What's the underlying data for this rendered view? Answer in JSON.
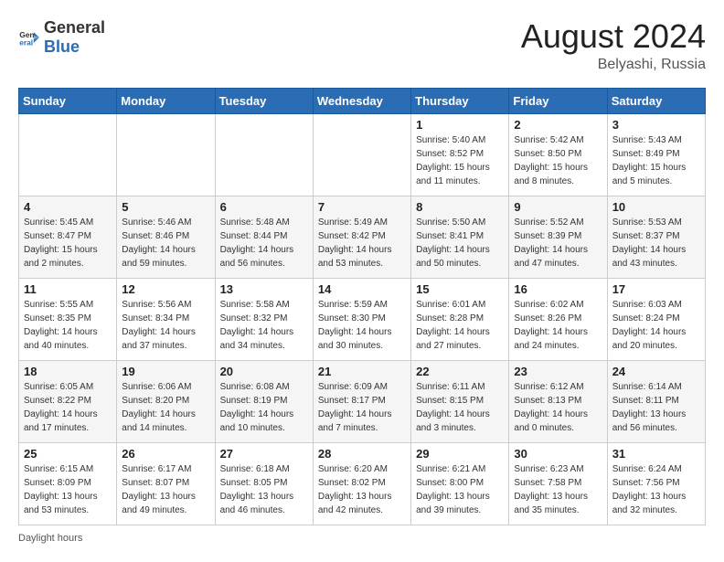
{
  "logo": {
    "general": "General",
    "blue": "Blue"
  },
  "title": {
    "month_year": "August 2024",
    "location": "Belyashi, Russia"
  },
  "days_of_week": [
    "Sunday",
    "Monday",
    "Tuesday",
    "Wednesday",
    "Thursday",
    "Friday",
    "Saturday"
  ],
  "weeks": [
    [
      {
        "day": "",
        "sunrise": "",
        "sunset": "",
        "daylight": ""
      },
      {
        "day": "",
        "sunrise": "",
        "sunset": "",
        "daylight": ""
      },
      {
        "day": "",
        "sunrise": "",
        "sunset": "",
        "daylight": ""
      },
      {
        "day": "",
        "sunrise": "",
        "sunset": "",
        "daylight": ""
      },
      {
        "day": "1",
        "sunrise": "Sunrise: 5:40 AM",
        "sunset": "Sunset: 8:52 PM",
        "daylight": "Daylight: 15 hours and 11 minutes."
      },
      {
        "day": "2",
        "sunrise": "Sunrise: 5:42 AM",
        "sunset": "Sunset: 8:50 PM",
        "daylight": "Daylight: 15 hours and 8 minutes."
      },
      {
        "day": "3",
        "sunrise": "Sunrise: 5:43 AM",
        "sunset": "Sunset: 8:49 PM",
        "daylight": "Daylight: 15 hours and 5 minutes."
      }
    ],
    [
      {
        "day": "4",
        "sunrise": "Sunrise: 5:45 AM",
        "sunset": "Sunset: 8:47 PM",
        "daylight": "Daylight: 15 hours and 2 minutes."
      },
      {
        "day": "5",
        "sunrise": "Sunrise: 5:46 AM",
        "sunset": "Sunset: 8:46 PM",
        "daylight": "Daylight: 14 hours and 59 minutes."
      },
      {
        "day": "6",
        "sunrise": "Sunrise: 5:48 AM",
        "sunset": "Sunset: 8:44 PM",
        "daylight": "Daylight: 14 hours and 56 minutes."
      },
      {
        "day": "7",
        "sunrise": "Sunrise: 5:49 AM",
        "sunset": "Sunset: 8:42 PM",
        "daylight": "Daylight: 14 hours and 53 minutes."
      },
      {
        "day": "8",
        "sunrise": "Sunrise: 5:50 AM",
        "sunset": "Sunset: 8:41 PM",
        "daylight": "Daylight: 14 hours and 50 minutes."
      },
      {
        "day": "9",
        "sunrise": "Sunrise: 5:52 AM",
        "sunset": "Sunset: 8:39 PM",
        "daylight": "Daylight: 14 hours and 47 minutes."
      },
      {
        "day": "10",
        "sunrise": "Sunrise: 5:53 AM",
        "sunset": "Sunset: 8:37 PM",
        "daylight": "Daylight: 14 hours and 43 minutes."
      }
    ],
    [
      {
        "day": "11",
        "sunrise": "Sunrise: 5:55 AM",
        "sunset": "Sunset: 8:35 PM",
        "daylight": "Daylight: 14 hours and 40 minutes."
      },
      {
        "day": "12",
        "sunrise": "Sunrise: 5:56 AM",
        "sunset": "Sunset: 8:34 PM",
        "daylight": "Daylight: 14 hours and 37 minutes."
      },
      {
        "day": "13",
        "sunrise": "Sunrise: 5:58 AM",
        "sunset": "Sunset: 8:32 PM",
        "daylight": "Daylight: 14 hours and 34 minutes."
      },
      {
        "day": "14",
        "sunrise": "Sunrise: 5:59 AM",
        "sunset": "Sunset: 8:30 PM",
        "daylight": "Daylight: 14 hours and 30 minutes."
      },
      {
        "day": "15",
        "sunrise": "Sunrise: 6:01 AM",
        "sunset": "Sunset: 8:28 PM",
        "daylight": "Daylight: 14 hours and 27 minutes."
      },
      {
        "day": "16",
        "sunrise": "Sunrise: 6:02 AM",
        "sunset": "Sunset: 8:26 PM",
        "daylight": "Daylight: 14 hours and 24 minutes."
      },
      {
        "day": "17",
        "sunrise": "Sunrise: 6:03 AM",
        "sunset": "Sunset: 8:24 PM",
        "daylight": "Daylight: 14 hours and 20 minutes."
      }
    ],
    [
      {
        "day": "18",
        "sunrise": "Sunrise: 6:05 AM",
        "sunset": "Sunset: 8:22 PM",
        "daylight": "Daylight: 14 hours and 17 minutes."
      },
      {
        "day": "19",
        "sunrise": "Sunrise: 6:06 AM",
        "sunset": "Sunset: 8:20 PM",
        "daylight": "Daylight: 14 hours and 14 minutes."
      },
      {
        "day": "20",
        "sunrise": "Sunrise: 6:08 AM",
        "sunset": "Sunset: 8:19 PM",
        "daylight": "Daylight: 14 hours and 10 minutes."
      },
      {
        "day": "21",
        "sunrise": "Sunrise: 6:09 AM",
        "sunset": "Sunset: 8:17 PM",
        "daylight": "Daylight: 14 hours and 7 minutes."
      },
      {
        "day": "22",
        "sunrise": "Sunrise: 6:11 AM",
        "sunset": "Sunset: 8:15 PM",
        "daylight": "Daylight: 14 hours and 3 minutes."
      },
      {
        "day": "23",
        "sunrise": "Sunrise: 6:12 AM",
        "sunset": "Sunset: 8:13 PM",
        "daylight": "Daylight: 14 hours and 0 minutes."
      },
      {
        "day": "24",
        "sunrise": "Sunrise: 6:14 AM",
        "sunset": "Sunset: 8:11 PM",
        "daylight": "Daylight: 13 hours and 56 minutes."
      }
    ],
    [
      {
        "day": "25",
        "sunrise": "Sunrise: 6:15 AM",
        "sunset": "Sunset: 8:09 PM",
        "daylight": "Daylight: 13 hours and 53 minutes."
      },
      {
        "day": "26",
        "sunrise": "Sunrise: 6:17 AM",
        "sunset": "Sunset: 8:07 PM",
        "daylight": "Daylight: 13 hours and 49 minutes."
      },
      {
        "day": "27",
        "sunrise": "Sunrise: 6:18 AM",
        "sunset": "Sunset: 8:05 PM",
        "daylight": "Daylight: 13 hours and 46 minutes."
      },
      {
        "day": "28",
        "sunrise": "Sunrise: 6:20 AM",
        "sunset": "Sunset: 8:02 PM",
        "daylight": "Daylight: 13 hours and 42 minutes."
      },
      {
        "day": "29",
        "sunrise": "Sunrise: 6:21 AM",
        "sunset": "Sunset: 8:00 PM",
        "daylight": "Daylight: 13 hours and 39 minutes."
      },
      {
        "day": "30",
        "sunrise": "Sunrise: 6:23 AM",
        "sunset": "Sunset: 7:58 PM",
        "daylight": "Daylight: 13 hours and 35 minutes."
      },
      {
        "day": "31",
        "sunrise": "Sunrise: 6:24 AM",
        "sunset": "Sunset: 7:56 PM",
        "daylight": "Daylight: 13 hours and 32 minutes."
      }
    ]
  ],
  "footer": {
    "daylight_hours": "Daylight hours"
  }
}
